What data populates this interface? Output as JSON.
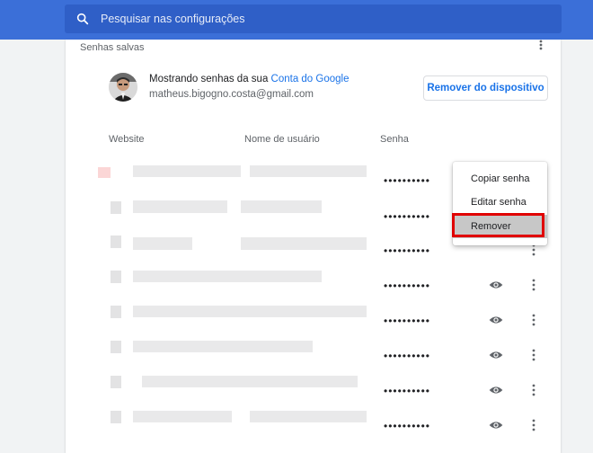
{
  "search": {
    "placeholder": "Pesquisar nas configurações",
    "icon": "search-icon"
  },
  "section": {
    "title": "Senhas salvas",
    "more_icon": "more-vert-icon"
  },
  "account": {
    "showing_prefix": "Mostrando senhas da sua ",
    "link_label": "Conta do Google",
    "email": "matheus.bigogno.costa@gmail.com",
    "remove_device_label": "Remover do dispositivo"
  },
  "table": {
    "headers": [
      "Website",
      "Nome de usuário",
      "Senha"
    ],
    "rows": [
      {
        "password": "••••••••••"
      },
      {
        "password": "••••••••••"
      },
      {
        "password": "••••••••••"
      },
      {
        "password": "••••••••••"
      },
      {
        "password": "••••••••••"
      },
      {
        "password": "••••••••••"
      },
      {
        "password": "••••••••••"
      },
      {
        "password": "••••••••••"
      }
    ]
  },
  "context_menu": {
    "items": [
      "Copiar senha",
      "Editar senha",
      "Remover"
    ],
    "highlighted_item": "Remover",
    "highlight_color": "#e00000"
  },
  "colors": {
    "topbar": "#3b6fd8",
    "link": "#1a73e8"
  }
}
